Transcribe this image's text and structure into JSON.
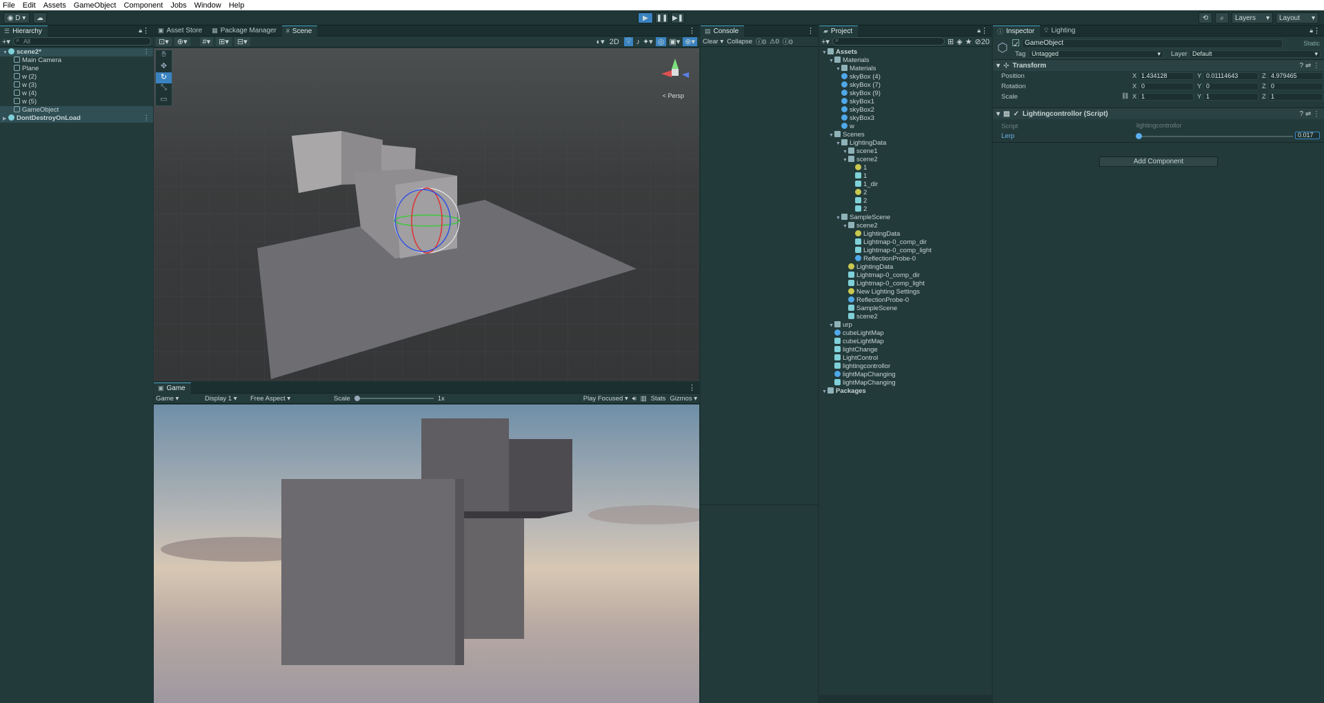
{
  "menu": [
    "File",
    "Edit",
    "Assets",
    "GameObject",
    "Component",
    "Jobs",
    "Window",
    "Help"
  ],
  "toolbar": {
    "account": "D",
    "layers": "Layers",
    "layout": "Layout"
  },
  "hierarchy": {
    "tab": "Hierarchy",
    "search": "All",
    "items": [
      {
        "label": "scene2*",
        "depth": 0,
        "icon": "scene-icon",
        "selected": true
      },
      {
        "label": "Main Camera",
        "depth": 2,
        "icon": "gameobject-icon"
      },
      {
        "label": "Plane",
        "depth": 2,
        "icon": "gameobject-icon"
      },
      {
        "label": "w (2)",
        "depth": 2,
        "icon": "gameobject-icon"
      },
      {
        "label": "w (3)",
        "depth": 2,
        "icon": "gameobject-icon"
      },
      {
        "label": "w (4)",
        "depth": 2,
        "icon": "gameobject-icon"
      },
      {
        "label": "w (5)",
        "depth": 2,
        "icon": "gameobject-icon"
      },
      {
        "label": "GameObject",
        "depth": 2,
        "icon": "gameobject-icon",
        "selected": true
      },
      {
        "label": "DontDestroyOnLoad",
        "depth": 0,
        "icon": "scene-icon",
        "selected": true
      }
    ]
  },
  "scene": {
    "tabs": [
      "Scene",
      "Asset Store",
      "Package Manager"
    ],
    "mode_2d": "2D",
    "persp": "< Persp"
  },
  "game": {
    "tab": "Game",
    "view": "Game",
    "display": "Display 1",
    "aspect": "Free Aspect",
    "scale_label": "Scale",
    "scale_value": "1x",
    "play_focused": "Play Focused",
    "stats": "Stats",
    "gizmos": "Gizmos"
  },
  "console": {
    "tab": "Console",
    "clear": "Clear",
    "collapse": "Collapse",
    "counts": [
      "0",
      "0",
      "0"
    ]
  },
  "project": {
    "tab": "Project",
    "count": "20",
    "items": [
      {
        "label": "Assets",
        "depth": 0,
        "type": "folder",
        "bold": true
      },
      {
        "label": "Materials",
        "depth": 1,
        "type": "folder"
      },
      {
        "label": "Materials",
        "depth": 2,
        "type": "folder"
      },
      {
        "label": "skyBox (4)",
        "depth": 2,
        "type": "material"
      },
      {
        "label": "skyBox (7)",
        "depth": 2,
        "type": "material"
      },
      {
        "label": "skyBox (9)",
        "depth": 2,
        "type": "material"
      },
      {
        "label": "skyBox1",
        "depth": 2,
        "type": "sphere"
      },
      {
        "label": "skyBox2",
        "depth": 2,
        "type": "sphere"
      },
      {
        "label": "skyBox3",
        "depth": 2,
        "type": "sphere"
      },
      {
        "label": "w",
        "depth": 2,
        "type": "sphere"
      },
      {
        "label": "Scenes",
        "depth": 1,
        "type": "folder"
      },
      {
        "label": "LightingData",
        "depth": 2,
        "type": "folder"
      },
      {
        "label": "scene1",
        "depth": 3,
        "type": "folder"
      },
      {
        "label": "scene2",
        "depth": 3,
        "type": "folder"
      },
      {
        "label": "1",
        "depth": 4,
        "type": "yellow"
      },
      {
        "label": "1",
        "depth": 4,
        "type": "file"
      },
      {
        "label": "1_dir",
        "depth": 4,
        "type": "texture"
      },
      {
        "label": "2",
        "depth": 4,
        "type": "yellow"
      },
      {
        "label": "2",
        "depth": 4,
        "type": "file"
      },
      {
        "label": "2",
        "depth": 4,
        "type": "texture"
      },
      {
        "label": "SampleScene",
        "depth": 2,
        "type": "folder"
      },
      {
        "label": "scene2",
        "depth": 3,
        "type": "folder"
      },
      {
        "label": "LightingData",
        "depth": 4,
        "type": "yellow"
      },
      {
        "label": "Lightmap-0_comp_dir",
        "depth": 4,
        "type": "texture"
      },
      {
        "label": "Lightmap-0_comp_light",
        "depth": 4,
        "type": "file"
      },
      {
        "label": "ReflectionProbe-0",
        "depth": 4,
        "type": "material"
      },
      {
        "label": "LightingData",
        "depth": 3,
        "type": "yellow"
      },
      {
        "label": "Lightmap-0_comp_dir",
        "depth": 3,
        "type": "texture"
      },
      {
        "label": "Lightmap-0_comp_light",
        "depth": 3,
        "type": "file"
      },
      {
        "label": "New Lighting Settings",
        "depth": 3,
        "type": "yellow"
      },
      {
        "label": "ReflectionProbe-0",
        "depth": 3,
        "type": "material"
      },
      {
        "label": "SampleScene",
        "depth": 3,
        "type": "scene"
      },
      {
        "label": "scene2",
        "depth": 3,
        "type": "scene"
      },
      {
        "label": "urp",
        "depth": 1,
        "type": "folder"
      },
      {
        "label": "cubeLightMap",
        "depth": 1,
        "type": "sphere"
      },
      {
        "label": "cubeLightMap",
        "depth": 1,
        "type": "file"
      },
      {
        "label": "lightChange",
        "depth": 1,
        "type": "script"
      },
      {
        "label": "LightControl",
        "depth": 1,
        "type": "script"
      },
      {
        "label": "lightingcontrollor",
        "depth": 1,
        "type": "script"
      },
      {
        "label": "lightMapChanging",
        "depth": 1,
        "type": "sphere"
      },
      {
        "label": "lightMapChanging",
        "depth": 1,
        "type": "file"
      },
      {
        "label": "Packages",
        "depth": 0,
        "type": "folder",
        "bold": true
      }
    ]
  },
  "inspector": {
    "tabs": [
      "Inspector",
      "Lighting"
    ],
    "name": "GameObject",
    "static": "Static",
    "tag_label": "Tag",
    "tag": "Untagged",
    "layer_label": "Layer",
    "layer": "Default",
    "transform": {
      "title": "Transform",
      "position": {
        "label": "Position",
        "x": "1.434128",
        "y": "0.01114643",
        "z": "4.979465"
      },
      "rotation": {
        "label": "Rotation",
        "x": "0",
        "y": "0",
        "z": "0"
      },
      "scale": {
        "label": "Scale",
        "x": "1",
        "y": "1",
        "z": "1"
      }
    },
    "script": {
      "title": "Lightingcontrollor (Script)",
      "script_label": "Script",
      "script_value": "lightingcontrollor",
      "lerp_label": "Lerp",
      "lerp_value": "0.017",
      "lerp_fraction": 0.017
    },
    "add_component": "Add Component"
  },
  "axis": {
    "x": "X",
    "y": "Y",
    "z": "Z"
  }
}
